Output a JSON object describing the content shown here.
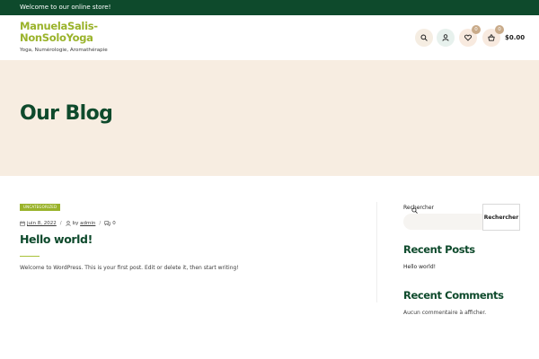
{
  "topbar": {
    "message": "Welcome to our online store!"
  },
  "site": {
    "name": "ManuelaSalis-NonSoloYoga",
    "tagline": "Yoga, Numérologie, Aromathérapie"
  },
  "header": {
    "wishlist_count": "0",
    "cart_count": "0",
    "cart_total": "$0.00",
    "icons": [
      "search-icon",
      "user-icon",
      "heart-icon",
      "basket-icon"
    ]
  },
  "hero": {
    "title": "Our Blog"
  },
  "post": {
    "category": "Uncategorized",
    "date": "juin 8, 2022",
    "author_prefix": "by",
    "author": "admin",
    "comments": "0",
    "title": "Hello world!",
    "excerpt": "Welcome to WordPress. This is your first post. Edit or delete it, then start writing!"
  },
  "sidebar": {
    "search": {
      "label": "Rechercher",
      "value": "",
      "button": "Rechercher"
    },
    "recent_posts": {
      "title": "Recent Posts",
      "items": [
        "Hello world!"
      ]
    },
    "recent_comments": {
      "title": "Recent Comments",
      "empty_text": "Aucun commentaire à afficher."
    }
  },
  "colors": {
    "brand_dark_green": "#0e4a2c",
    "brand_lime": "#9ab32b",
    "hero_background": "#f7ede1"
  }
}
